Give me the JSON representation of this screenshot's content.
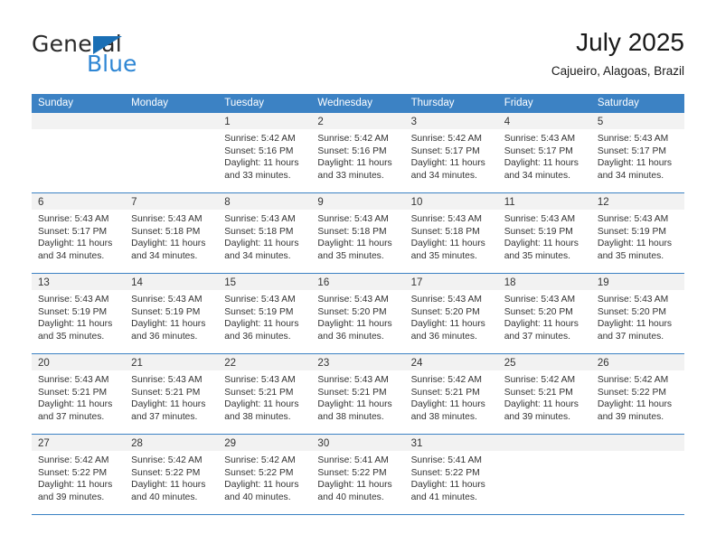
{
  "brand": {
    "name_top": "General",
    "name_bottom": "Blue",
    "accent_color": "#2e86d4",
    "triangle_color": "#1a6fb5"
  },
  "header": {
    "title": "July 2025",
    "subtitle": "Cajueiro, Alagoas, Brazil"
  },
  "theme": {
    "header_band": "#3c82c4",
    "daynum_strip": "#f2f2f2",
    "row_divider": "#3c82c4",
    "text": "#333333"
  },
  "weekdays": [
    "Sunday",
    "Monday",
    "Tuesday",
    "Wednesday",
    "Thursday",
    "Friday",
    "Saturday"
  ],
  "labels": {
    "sunrise_prefix": "Sunrise:",
    "sunset_prefix": "Sunset:",
    "daylight_prefix": "Daylight:"
  },
  "weeks": [
    [
      {
        "day": "",
        "sunrise": "",
        "sunset": "",
        "daylight_line1": "",
        "daylight_line2": ""
      },
      {
        "day": "",
        "sunrise": "",
        "sunset": "",
        "daylight_line1": "",
        "daylight_line2": ""
      },
      {
        "day": "1",
        "sunrise": "Sunrise: 5:42 AM",
        "sunset": "Sunset: 5:16 PM",
        "daylight_line1": "Daylight: 11 hours",
        "daylight_line2": "and 33 minutes."
      },
      {
        "day": "2",
        "sunrise": "Sunrise: 5:42 AM",
        "sunset": "Sunset: 5:16 PM",
        "daylight_line1": "Daylight: 11 hours",
        "daylight_line2": "and 33 minutes."
      },
      {
        "day": "3",
        "sunrise": "Sunrise: 5:42 AM",
        "sunset": "Sunset: 5:17 PM",
        "daylight_line1": "Daylight: 11 hours",
        "daylight_line2": "and 34 minutes."
      },
      {
        "day": "4",
        "sunrise": "Sunrise: 5:43 AM",
        "sunset": "Sunset: 5:17 PM",
        "daylight_line1": "Daylight: 11 hours",
        "daylight_line2": "and 34 minutes."
      },
      {
        "day": "5",
        "sunrise": "Sunrise: 5:43 AM",
        "sunset": "Sunset: 5:17 PM",
        "daylight_line1": "Daylight: 11 hours",
        "daylight_line2": "and 34 minutes."
      }
    ],
    [
      {
        "day": "6",
        "sunrise": "Sunrise: 5:43 AM",
        "sunset": "Sunset: 5:17 PM",
        "daylight_line1": "Daylight: 11 hours",
        "daylight_line2": "and 34 minutes."
      },
      {
        "day": "7",
        "sunrise": "Sunrise: 5:43 AM",
        "sunset": "Sunset: 5:18 PM",
        "daylight_line1": "Daylight: 11 hours",
        "daylight_line2": "and 34 minutes."
      },
      {
        "day": "8",
        "sunrise": "Sunrise: 5:43 AM",
        "sunset": "Sunset: 5:18 PM",
        "daylight_line1": "Daylight: 11 hours",
        "daylight_line2": "and 34 minutes."
      },
      {
        "day": "9",
        "sunrise": "Sunrise: 5:43 AM",
        "sunset": "Sunset: 5:18 PM",
        "daylight_line1": "Daylight: 11 hours",
        "daylight_line2": "and 35 minutes."
      },
      {
        "day": "10",
        "sunrise": "Sunrise: 5:43 AM",
        "sunset": "Sunset: 5:18 PM",
        "daylight_line1": "Daylight: 11 hours",
        "daylight_line2": "and 35 minutes."
      },
      {
        "day": "11",
        "sunrise": "Sunrise: 5:43 AM",
        "sunset": "Sunset: 5:19 PM",
        "daylight_line1": "Daylight: 11 hours",
        "daylight_line2": "and 35 minutes."
      },
      {
        "day": "12",
        "sunrise": "Sunrise: 5:43 AM",
        "sunset": "Sunset: 5:19 PM",
        "daylight_line1": "Daylight: 11 hours",
        "daylight_line2": "and 35 minutes."
      }
    ],
    [
      {
        "day": "13",
        "sunrise": "Sunrise: 5:43 AM",
        "sunset": "Sunset: 5:19 PM",
        "daylight_line1": "Daylight: 11 hours",
        "daylight_line2": "and 35 minutes."
      },
      {
        "day": "14",
        "sunrise": "Sunrise: 5:43 AM",
        "sunset": "Sunset: 5:19 PM",
        "daylight_line1": "Daylight: 11 hours",
        "daylight_line2": "and 36 minutes."
      },
      {
        "day": "15",
        "sunrise": "Sunrise: 5:43 AM",
        "sunset": "Sunset: 5:19 PM",
        "daylight_line1": "Daylight: 11 hours",
        "daylight_line2": "and 36 minutes."
      },
      {
        "day": "16",
        "sunrise": "Sunrise: 5:43 AM",
        "sunset": "Sunset: 5:20 PM",
        "daylight_line1": "Daylight: 11 hours",
        "daylight_line2": "and 36 minutes."
      },
      {
        "day": "17",
        "sunrise": "Sunrise: 5:43 AM",
        "sunset": "Sunset: 5:20 PM",
        "daylight_line1": "Daylight: 11 hours",
        "daylight_line2": "and 36 minutes."
      },
      {
        "day": "18",
        "sunrise": "Sunrise: 5:43 AM",
        "sunset": "Sunset: 5:20 PM",
        "daylight_line1": "Daylight: 11 hours",
        "daylight_line2": "and 37 minutes."
      },
      {
        "day": "19",
        "sunrise": "Sunrise: 5:43 AM",
        "sunset": "Sunset: 5:20 PM",
        "daylight_line1": "Daylight: 11 hours",
        "daylight_line2": "and 37 minutes."
      }
    ],
    [
      {
        "day": "20",
        "sunrise": "Sunrise: 5:43 AM",
        "sunset": "Sunset: 5:21 PM",
        "daylight_line1": "Daylight: 11 hours",
        "daylight_line2": "and 37 minutes."
      },
      {
        "day": "21",
        "sunrise": "Sunrise: 5:43 AM",
        "sunset": "Sunset: 5:21 PM",
        "daylight_line1": "Daylight: 11 hours",
        "daylight_line2": "and 37 minutes."
      },
      {
        "day": "22",
        "sunrise": "Sunrise: 5:43 AM",
        "sunset": "Sunset: 5:21 PM",
        "daylight_line1": "Daylight: 11 hours",
        "daylight_line2": "and 38 minutes."
      },
      {
        "day": "23",
        "sunrise": "Sunrise: 5:43 AM",
        "sunset": "Sunset: 5:21 PM",
        "daylight_line1": "Daylight: 11 hours",
        "daylight_line2": "and 38 minutes."
      },
      {
        "day": "24",
        "sunrise": "Sunrise: 5:42 AM",
        "sunset": "Sunset: 5:21 PM",
        "daylight_line1": "Daylight: 11 hours",
        "daylight_line2": "and 38 minutes."
      },
      {
        "day": "25",
        "sunrise": "Sunrise: 5:42 AM",
        "sunset": "Sunset: 5:21 PM",
        "daylight_line1": "Daylight: 11 hours",
        "daylight_line2": "and 39 minutes."
      },
      {
        "day": "26",
        "sunrise": "Sunrise: 5:42 AM",
        "sunset": "Sunset: 5:22 PM",
        "daylight_line1": "Daylight: 11 hours",
        "daylight_line2": "and 39 minutes."
      }
    ],
    [
      {
        "day": "27",
        "sunrise": "Sunrise: 5:42 AM",
        "sunset": "Sunset: 5:22 PM",
        "daylight_line1": "Daylight: 11 hours",
        "daylight_line2": "and 39 minutes."
      },
      {
        "day": "28",
        "sunrise": "Sunrise: 5:42 AM",
        "sunset": "Sunset: 5:22 PM",
        "daylight_line1": "Daylight: 11 hours",
        "daylight_line2": "and 40 minutes."
      },
      {
        "day": "29",
        "sunrise": "Sunrise: 5:42 AM",
        "sunset": "Sunset: 5:22 PM",
        "daylight_line1": "Daylight: 11 hours",
        "daylight_line2": "and 40 minutes."
      },
      {
        "day": "30",
        "sunrise": "Sunrise: 5:41 AM",
        "sunset": "Sunset: 5:22 PM",
        "daylight_line1": "Daylight: 11 hours",
        "daylight_line2": "and 40 minutes."
      },
      {
        "day": "31",
        "sunrise": "Sunrise: 5:41 AM",
        "sunset": "Sunset: 5:22 PM",
        "daylight_line1": "Daylight: 11 hours",
        "daylight_line2": "and 41 minutes."
      },
      {
        "day": "",
        "sunrise": "",
        "sunset": "",
        "daylight_line1": "",
        "daylight_line2": ""
      },
      {
        "day": "",
        "sunrise": "",
        "sunset": "",
        "daylight_line1": "",
        "daylight_line2": ""
      }
    ]
  ]
}
